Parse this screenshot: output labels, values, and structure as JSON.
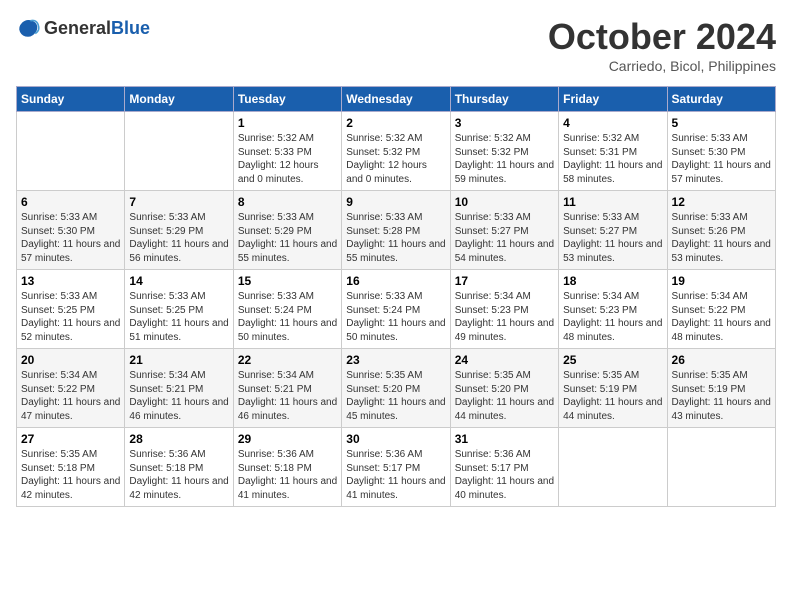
{
  "header": {
    "logo_general": "General",
    "logo_blue": "Blue",
    "month_title": "October 2024",
    "location": "Carriedo, Bicol, Philippines"
  },
  "weekdays": [
    "Sunday",
    "Monday",
    "Tuesday",
    "Wednesday",
    "Thursday",
    "Friday",
    "Saturday"
  ],
  "weeks": [
    [
      {
        "day": "",
        "sunrise": "",
        "sunset": "",
        "daylight": ""
      },
      {
        "day": "",
        "sunrise": "",
        "sunset": "",
        "daylight": ""
      },
      {
        "day": "1",
        "sunrise": "Sunrise: 5:32 AM",
        "sunset": "Sunset: 5:33 PM",
        "daylight": "Daylight: 12 hours and 0 minutes."
      },
      {
        "day": "2",
        "sunrise": "Sunrise: 5:32 AM",
        "sunset": "Sunset: 5:32 PM",
        "daylight": "Daylight: 12 hours and 0 minutes."
      },
      {
        "day": "3",
        "sunrise": "Sunrise: 5:32 AM",
        "sunset": "Sunset: 5:32 PM",
        "daylight": "Daylight: 11 hours and 59 minutes."
      },
      {
        "day": "4",
        "sunrise": "Sunrise: 5:32 AM",
        "sunset": "Sunset: 5:31 PM",
        "daylight": "Daylight: 11 hours and 58 minutes."
      },
      {
        "day": "5",
        "sunrise": "Sunrise: 5:33 AM",
        "sunset": "Sunset: 5:30 PM",
        "daylight": "Daylight: 11 hours and 57 minutes."
      }
    ],
    [
      {
        "day": "6",
        "sunrise": "Sunrise: 5:33 AM",
        "sunset": "Sunset: 5:30 PM",
        "daylight": "Daylight: 11 hours and 57 minutes."
      },
      {
        "day": "7",
        "sunrise": "Sunrise: 5:33 AM",
        "sunset": "Sunset: 5:29 PM",
        "daylight": "Daylight: 11 hours and 56 minutes."
      },
      {
        "day": "8",
        "sunrise": "Sunrise: 5:33 AM",
        "sunset": "Sunset: 5:29 PM",
        "daylight": "Daylight: 11 hours and 55 minutes."
      },
      {
        "day": "9",
        "sunrise": "Sunrise: 5:33 AM",
        "sunset": "Sunset: 5:28 PM",
        "daylight": "Daylight: 11 hours and 55 minutes."
      },
      {
        "day": "10",
        "sunrise": "Sunrise: 5:33 AM",
        "sunset": "Sunset: 5:27 PM",
        "daylight": "Daylight: 11 hours and 54 minutes."
      },
      {
        "day": "11",
        "sunrise": "Sunrise: 5:33 AM",
        "sunset": "Sunset: 5:27 PM",
        "daylight": "Daylight: 11 hours and 53 minutes."
      },
      {
        "day": "12",
        "sunrise": "Sunrise: 5:33 AM",
        "sunset": "Sunset: 5:26 PM",
        "daylight": "Daylight: 11 hours and 53 minutes."
      }
    ],
    [
      {
        "day": "13",
        "sunrise": "Sunrise: 5:33 AM",
        "sunset": "Sunset: 5:25 PM",
        "daylight": "Daylight: 11 hours and 52 minutes."
      },
      {
        "day": "14",
        "sunrise": "Sunrise: 5:33 AM",
        "sunset": "Sunset: 5:25 PM",
        "daylight": "Daylight: 11 hours and 51 minutes."
      },
      {
        "day": "15",
        "sunrise": "Sunrise: 5:33 AM",
        "sunset": "Sunset: 5:24 PM",
        "daylight": "Daylight: 11 hours and 50 minutes."
      },
      {
        "day": "16",
        "sunrise": "Sunrise: 5:33 AM",
        "sunset": "Sunset: 5:24 PM",
        "daylight": "Daylight: 11 hours and 50 minutes."
      },
      {
        "day": "17",
        "sunrise": "Sunrise: 5:34 AM",
        "sunset": "Sunset: 5:23 PM",
        "daylight": "Daylight: 11 hours and 49 minutes."
      },
      {
        "day": "18",
        "sunrise": "Sunrise: 5:34 AM",
        "sunset": "Sunset: 5:23 PM",
        "daylight": "Daylight: 11 hours and 48 minutes."
      },
      {
        "day": "19",
        "sunrise": "Sunrise: 5:34 AM",
        "sunset": "Sunset: 5:22 PM",
        "daylight": "Daylight: 11 hours and 48 minutes."
      }
    ],
    [
      {
        "day": "20",
        "sunrise": "Sunrise: 5:34 AM",
        "sunset": "Sunset: 5:22 PM",
        "daylight": "Daylight: 11 hours and 47 minutes."
      },
      {
        "day": "21",
        "sunrise": "Sunrise: 5:34 AM",
        "sunset": "Sunset: 5:21 PM",
        "daylight": "Daylight: 11 hours and 46 minutes."
      },
      {
        "day": "22",
        "sunrise": "Sunrise: 5:34 AM",
        "sunset": "Sunset: 5:21 PM",
        "daylight": "Daylight: 11 hours and 46 minutes."
      },
      {
        "day": "23",
        "sunrise": "Sunrise: 5:35 AM",
        "sunset": "Sunset: 5:20 PM",
        "daylight": "Daylight: 11 hours and 45 minutes."
      },
      {
        "day": "24",
        "sunrise": "Sunrise: 5:35 AM",
        "sunset": "Sunset: 5:20 PM",
        "daylight": "Daylight: 11 hours and 44 minutes."
      },
      {
        "day": "25",
        "sunrise": "Sunrise: 5:35 AM",
        "sunset": "Sunset: 5:19 PM",
        "daylight": "Daylight: 11 hours and 44 minutes."
      },
      {
        "day": "26",
        "sunrise": "Sunrise: 5:35 AM",
        "sunset": "Sunset: 5:19 PM",
        "daylight": "Daylight: 11 hours and 43 minutes."
      }
    ],
    [
      {
        "day": "27",
        "sunrise": "Sunrise: 5:35 AM",
        "sunset": "Sunset: 5:18 PM",
        "daylight": "Daylight: 11 hours and 42 minutes."
      },
      {
        "day": "28",
        "sunrise": "Sunrise: 5:36 AM",
        "sunset": "Sunset: 5:18 PM",
        "daylight": "Daylight: 11 hours and 42 minutes."
      },
      {
        "day": "29",
        "sunrise": "Sunrise: 5:36 AM",
        "sunset": "Sunset: 5:18 PM",
        "daylight": "Daylight: 11 hours and 41 minutes."
      },
      {
        "day": "30",
        "sunrise": "Sunrise: 5:36 AM",
        "sunset": "Sunset: 5:17 PM",
        "daylight": "Daylight: 11 hours and 41 minutes."
      },
      {
        "day": "31",
        "sunrise": "Sunrise: 5:36 AM",
        "sunset": "Sunset: 5:17 PM",
        "daylight": "Daylight: 11 hours and 40 minutes."
      },
      {
        "day": "",
        "sunrise": "",
        "sunset": "",
        "daylight": ""
      },
      {
        "day": "",
        "sunrise": "",
        "sunset": "",
        "daylight": ""
      }
    ]
  ]
}
